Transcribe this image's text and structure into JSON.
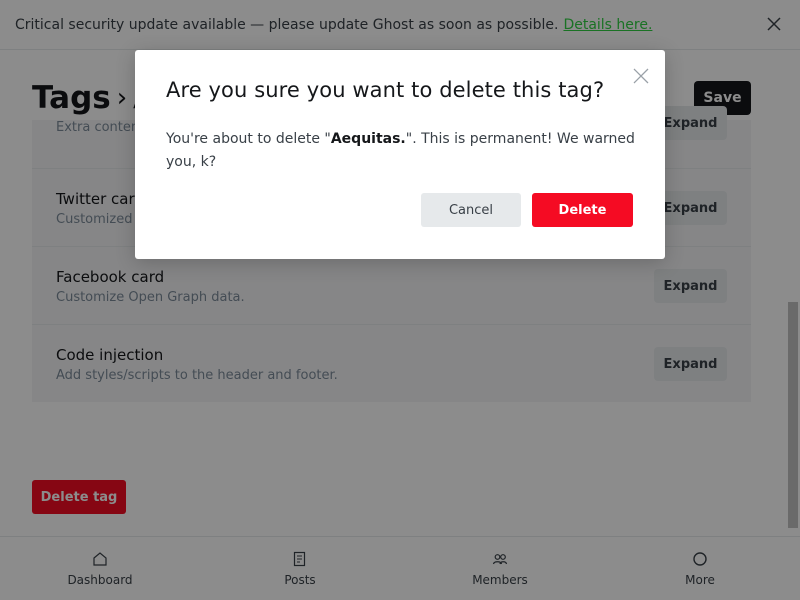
{
  "banner": {
    "text": "Critical security update available — please update Ghost as soon as possible.",
    "link": "Details here."
  },
  "header": {
    "title": "Tags",
    "title_tail": "A",
    "save_label": "Save"
  },
  "cards": [
    {
      "title": "",
      "subtitle": "Extra content",
      "button": "Expand"
    },
    {
      "title": "Twitter card",
      "subtitle": "Customized s",
      "button": "Expand"
    },
    {
      "title": "Facebook card",
      "subtitle": "Customize Open Graph data.",
      "button": "Expand"
    },
    {
      "title": "Code injection",
      "subtitle": "Add styles/scripts to the header and footer.",
      "button": "Expand"
    }
  ],
  "delete_tag_label": "Delete tag",
  "nav": [
    {
      "label": "Dashboard",
      "icon": "home-icon"
    },
    {
      "label": "Posts",
      "icon": "posts-icon"
    },
    {
      "label": "Members",
      "icon": "members-icon"
    },
    {
      "label": "More",
      "icon": "more-icon"
    }
  ],
  "modal": {
    "title": "Are you sure you want to delete this tag?",
    "body_pre": "You're about to delete \"",
    "tag_name": "Aequitas.",
    "body_post": "\". This is permanent! We warned you, k?",
    "cancel_label": "Cancel",
    "delete_label": "Delete"
  },
  "colors": {
    "accent_red": "#f50b23",
    "link_green": "#30cf43",
    "dark": "#15171a"
  }
}
